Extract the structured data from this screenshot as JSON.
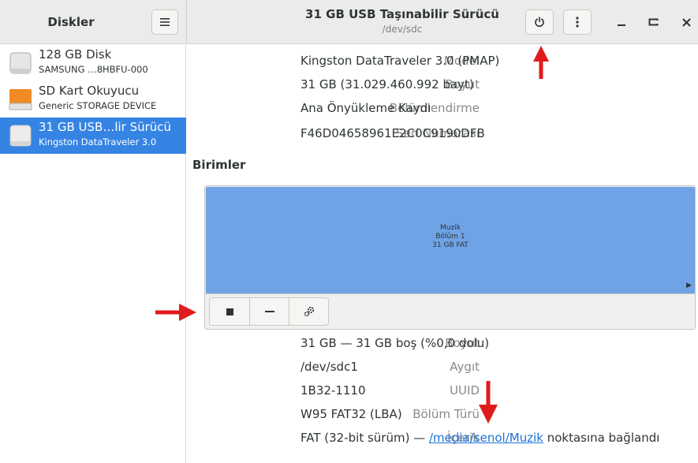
{
  "sidebar_title": "Diskler",
  "window": {
    "title": "31 GB USB Taşınabilir Sürücü",
    "subtitle": "/dev/sdc"
  },
  "drives": [
    {
      "name": "128 GB Disk",
      "detail": "SAMSUNG …8HBFU-000",
      "icon": "hard-disk-icon",
      "selected": false
    },
    {
      "name": "SD Kart Okuyucu",
      "detail": "Generic STORAGE DEVICE",
      "icon": "sd-card-icon",
      "selected": false
    },
    {
      "name": "31 GB USB…lir Sürücü",
      "detail": "Kingston DataTraveler 3.0",
      "icon": "usb-drive-icon",
      "selected": true
    }
  ],
  "drive_info": {
    "model_label": "Model",
    "model_value": "Kingston DataTraveler 3.0 (PMAP)",
    "size_label": "Boyut",
    "size_value": "31 GB (31.029.460.992 bayt)",
    "partitioning_label": "Bölümlendirme",
    "partitioning_value": "Ana Önyükleme Kaydı",
    "serial_label": "Seri Numarası",
    "serial_value": "F46D04658961E2C0C9190DFB"
  },
  "volumes_title": "Birimler",
  "partition": {
    "name": "Muzik",
    "number": "Bölüm 1",
    "size_fs": "31 GB FAT"
  },
  "volume_info": {
    "size_label": "Boyut",
    "size_value": "31 GB — 31 GB boş (%0,0 dolu)",
    "device_label": "Aygıt",
    "device_value": "/dev/sdc1",
    "uuid_label": "UUID",
    "uuid_value": "1B32-1110",
    "type_label": "Bölüm Türü",
    "type_value": "W95 FAT32 (LBA)",
    "content_label": "İçerik",
    "content_prefix": "FAT (32-bit sürüm) — ",
    "content_link": "/media/senol/Muzik",
    "content_suffix": " noktasına bağlandı"
  },
  "colors": {
    "accent": "#3584e4",
    "partition": "#6fa3e6",
    "annotation": "#e01b1b",
    "link": "#1c71d8"
  }
}
